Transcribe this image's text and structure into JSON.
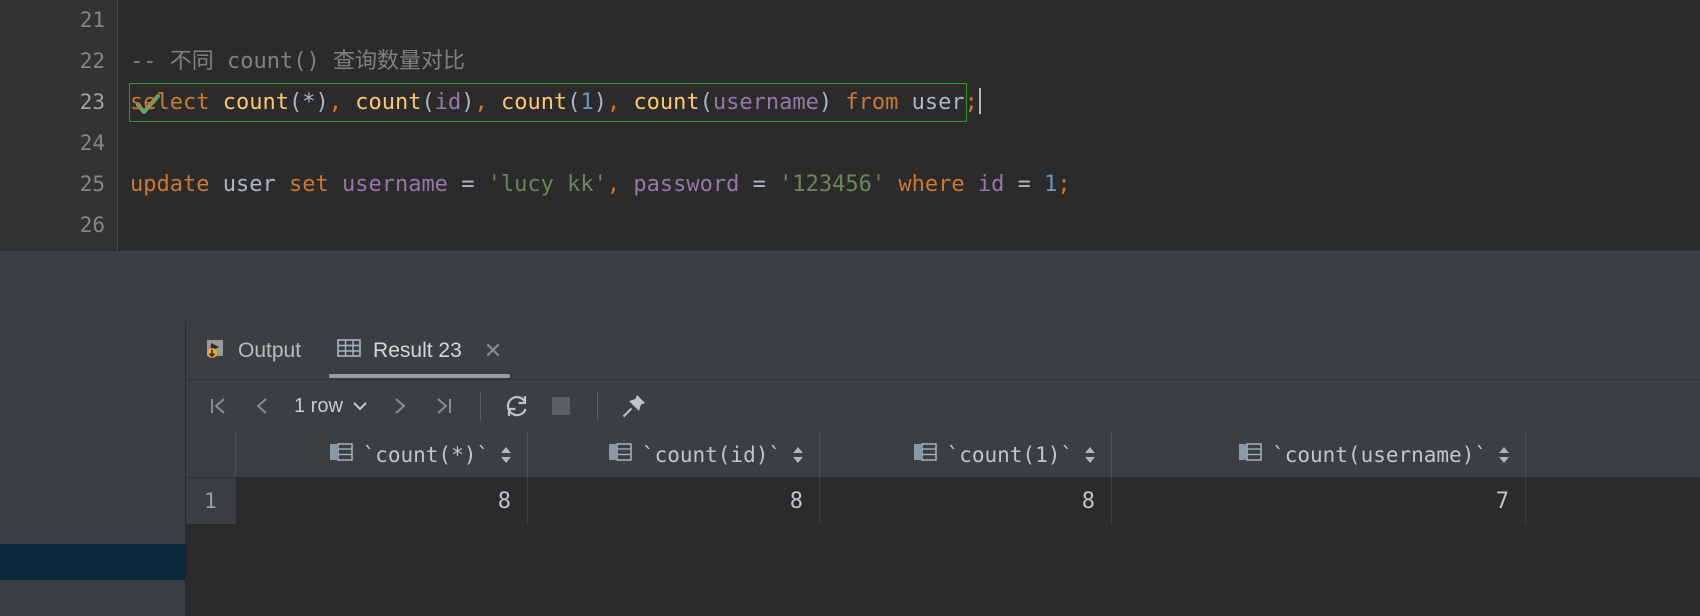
{
  "editor": {
    "lines": [
      {
        "number": "21",
        "marker": "",
        "tokens": []
      },
      {
        "number": "22",
        "marker": "",
        "tokens": [
          {
            "t": "-- 不同 count() 查询数量对比",
            "c": "cm"
          }
        ]
      },
      {
        "number": "23",
        "marker": "green-check-icon",
        "executed": true,
        "tokens": [
          {
            "t": "select",
            "c": "k"
          },
          {
            "t": " ",
            "c": "pl"
          },
          {
            "t": "count",
            "c": "fn"
          },
          {
            "t": "(",
            "c": "pl"
          },
          {
            "t": "*",
            "c": "pl"
          },
          {
            "t": ")",
            "c": "pl"
          },
          {
            "t": ",",
            "c": "k"
          },
          {
            "t": " ",
            "c": "pl"
          },
          {
            "t": "count",
            "c": "fn"
          },
          {
            "t": "(",
            "c": "pl"
          },
          {
            "t": "id",
            "c": "id"
          },
          {
            "t": ")",
            "c": "pl"
          },
          {
            "t": ",",
            "c": "k"
          },
          {
            "t": " ",
            "c": "pl"
          },
          {
            "t": "count",
            "c": "fn"
          },
          {
            "t": "(",
            "c": "pl"
          },
          {
            "t": "1",
            "c": "num"
          },
          {
            "t": ")",
            "c": "pl"
          },
          {
            "t": ",",
            "c": "k"
          },
          {
            "t": " ",
            "c": "pl"
          },
          {
            "t": "count",
            "c": "fn"
          },
          {
            "t": "(",
            "c": "pl"
          },
          {
            "t": "username",
            "c": "id"
          },
          {
            "t": ")",
            "c": "pl"
          },
          {
            "t": " ",
            "c": "pl"
          },
          {
            "t": "from",
            "c": "k"
          },
          {
            "t": " ",
            "c": "pl"
          },
          {
            "t": "user",
            "c": "pl"
          },
          {
            "t": ";",
            "c": "k"
          }
        ]
      },
      {
        "number": "24",
        "marker": "",
        "tokens": []
      },
      {
        "number": "25",
        "marker": "",
        "tokens": [
          {
            "t": "update",
            "c": "k"
          },
          {
            "t": " ",
            "c": "pl"
          },
          {
            "t": "user",
            "c": "pl"
          },
          {
            "t": " ",
            "c": "pl"
          },
          {
            "t": "set",
            "c": "k"
          },
          {
            "t": " ",
            "c": "pl"
          },
          {
            "t": "username",
            "c": "id"
          },
          {
            "t": " ",
            "c": "pl"
          },
          {
            "t": "=",
            "c": "op"
          },
          {
            "t": " ",
            "c": "pl"
          },
          {
            "t": "'lucy kk'",
            "c": "st"
          },
          {
            "t": ",",
            "c": "k"
          },
          {
            "t": " ",
            "c": "pl"
          },
          {
            "t": "password",
            "c": "id"
          },
          {
            "t": " ",
            "c": "pl"
          },
          {
            "t": "=",
            "c": "op"
          },
          {
            "t": " ",
            "c": "pl"
          },
          {
            "t": "'123456'",
            "c": "st"
          },
          {
            "t": " ",
            "c": "pl"
          },
          {
            "t": "where",
            "c": "k"
          },
          {
            "t": " ",
            "c": "pl"
          },
          {
            "t": "id",
            "c": "id"
          },
          {
            "t": " ",
            "c": "pl"
          },
          {
            "t": "=",
            "c": "op"
          },
          {
            "t": " ",
            "c": "pl"
          },
          {
            "t": "1",
            "c": "num"
          },
          {
            "t": ";",
            "c": "k"
          }
        ]
      },
      {
        "number": "26",
        "marker": "",
        "tokens": []
      }
    ],
    "caret_visible": true
  },
  "results_panel": {
    "tabs": [
      {
        "label": "Output",
        "icon": "run-output-icon",
        "active": false,
        "closable": false
      },
      {
        "label": "Result 23",
        "icon": "table-grid-icon",
        "active": true,
        "closable": true,
        "close_glyph": "✕"
      }
    ],
    "toolbar": {
      "first_page_label": "|‹",
      "prev_page_label": "‹",
      "row_count_label": "1 row",
      "row_count_chevron": "⌄",
      "next_page_label": "›",
      "last_page_label": "›|",
      "reload_label": "reload-icon",
      "stop_label": "stop-icon",
      "pin_label": "pin-icon"
    },
    "grid": {
      "row_number_header": "",
      "columns": [
        {
          "name": "`count(*)`",
          "icon": "column-icon",
          "sortable": true
        },
        {
          "name": "`count(id)`",
          "icon": "column-icon",
          "sortable": true
        },
        {
          "name": "`count(1)`",
          "icon": "column-icon",
          "sortable": true
        },
        {
          "name": "`count(username)`",
          "icon": "column-icon",
          "sortable": true
        }
      ],
      "rows": [
        {
          "num": "1",
          "values": [
            "8",
            "8",
            "8",
            "7"
          ]
        }
      ]
    }
  },
  "colors": {
    "editor_bg": "#2b2b2b",
    "gutter_bg": "#313335",
    "panel_bg": "#3c3f41",
    "exec_border": "#2d9a2d",
    "keyword": "#cc7832",
    "function": "#ffc66d",
    "identifier": "#9876aa",
    "string": "#6a8759",
    "number": "#6897bb",
    "comment": "#808080",
    "plain": "#a9b7c6",
    "selection_rail": "#0d293e"
  }
}
